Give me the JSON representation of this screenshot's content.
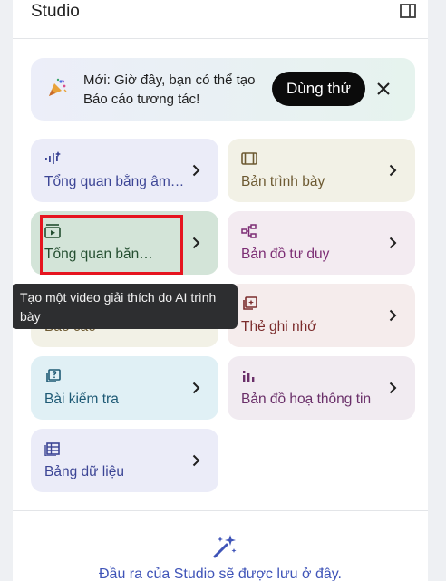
{
  "header": {
    "title": "Studio",
    "panel_toggle_icon": "panel-toggle-icon"
  },
  "banner": {
    "icon": "party-popper-icon",
    "text": "Mới: Giờ đây, bạn có thể tạo Báo cáo tương tác!",
    "try_label": "Dùng thử",
    "close_icon": "close-icon"
  },
  "tiles": [
    {
      "label": "Tổng quan bằng âm thanh",
      "icon": "audio-waveform-icon",
      "color": "#ebecf8"
    },
    {
      "label": "Bản trình bày",
      "icon": "slides-icon",
      "color": "#f2f1e6"
    },
    {
      "label": "Tổng quan bằng video",
      "icon": "video-icon",
      "color": "#d3e4d8"
    },
    {
      "label": "Bản đồ tư duy",
      "icon": "mind-map-icon",
      "color": "#f3ebf1"
    },
    {
      "label": "Báo cáo",
      "icon": "report-icon",
      "color": "#f2f1e6"
    },
    {
      "label": "Thẻ ghi nhớ",
      "icon": "flashcards-icon",
      "color": "#f5ecec"
    },
    {
      "label": "Bài kiểm tra",
      "icon": "quiz-icon",
      "color": "#e0f0f5"
    },
    {
      "label": "Bản đồ hoạ thông tin",
      "icon": "infographic-icon",
      "color": "#f1ebf1"
    },
    {
      "label": "Bảng dữ liệu",
      "icon": "data-table-icon",
      "color": "#ebecf8"
    }
  ],
  "tooltip": {
    "text": "Tạo một video giải thích do AI trình bày"
  },
  "footer": {
    "icon": "magic-wand-icon",
    "text": "Đầu ra của Studio sẽ được lưu ở đây."
  },
  "colors": {
    "accent": "#3f54b8",
    "highlight": "#e6141f",
    "tooltip_bg": "#2d2e30"
  }
}
